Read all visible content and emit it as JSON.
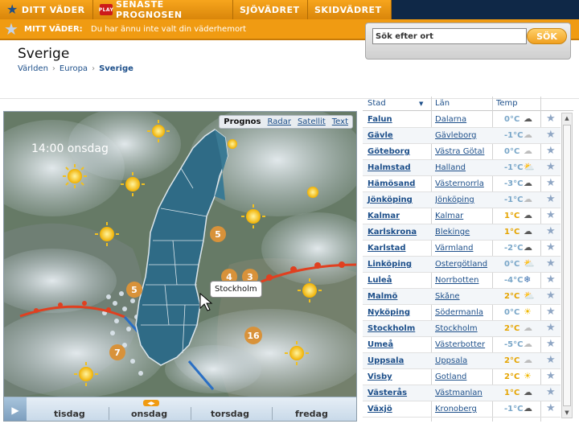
{
  "nav": {
    "tabs": [
      {
        "label": "DITT VÄDER"
      },
      {
        "label": "SENASTE PROGNOSEN"
      },
      {
        "label": "SJÖVÄDRET"
      },
      {
        "label": "SKIDVÄDRET"
      }
    ],
    "play_badge": "PLAY"
  },
  "subnav": {
    "label": "MITT VÄDER:",
    "message": "Du har ännu inte valt din väderhemort"
  },
  "search": {
    "value": "Sök efter ort",
    "button": "SÖK"
  },
  "page": {
    "title": "Sverige",
    "breadcrumb": [
      "Världen",
      "Europa",
      "Sverige"
    ]
  },
  "map": {
    "tabs": [
      "Prognos",
      "Radar",
      "Satellit",
      "Text"
    ],
    "time_label": "14:00 onsdag",
    "city_label": "Stockholm",
    "markers": [
      "5",
      "4",
      "3",
      "5",
      "7",
      "16"
    ],
    "days": [
      "tisdag",
      "onsdag",
      "torsdag",
      "fredag"
    ]
  },
  "table": {
    "headers": {
      "city": "Stad",
      "county": "Län",
      "temp": "Temp"
    },
    "rows": [
      {
        "city": "Falun",
        "county": "Dalarna",
        "temp": "0°C",
        "icon": "cloud-icon",
        "temp_color": "#7aa7c9"
      },
      {
        "city": "Gävle",
        "county": "Gävleborg",
        "temp": "-1°C",
        "icon": "cloud-outline-icon",
        "temp_color": "#7aa7c9"
      },
      {
        "city": "Göteborg",
        "county": "Västra Götal",
        "temp": "0°C",
        "icon": "cloud-outline-icon",
        "temp_color": "#7aa7c9"
      },
      {
        "city": "Halmstad",
        "county": "Halland",
        "temp": "-1°C",
        "icon": "partly-cloudy-icon",
        "temp_color": "#7aa7c9"
      },
      {
        "city": "Hämösand",
        "county": "Västernorrla",
        "temp": "-3°C",
        "icon": "cloud-icon",
        "temp_color": "#7aa7c9"
      },
      {
        "city": "Jönköping",
        "county": "Jönköping",
        "temp": "-1°C",
        "icon": "cloud-outline-icon",
        "temp_color": "#7aa7c9"
      },
      {
        "city": "Kalmar",
        "county": "Kalmar",
        "temp": "1°C",
        "icon": "cloud-icon",
        "temp_color": "#e5a400"
      },
      {
        "city": "Karlskrona",
        "county": "Blekinge",
        "temp": "1°C",
        "icon": "cloud-icon",
        "temp_color": "#e5a400"
      },
      {
        "city": "Karlstad",
        "county": "Värmland",
        "temp": "-2°C",
        "icon": "cloud-icon",
        "temp_color": "#7aa7c9"
      },
      {
        "city": "Linköping",
        "county": "Östergötland",
        "temp": "0°C",
        "icon": "partly-cloudy-icon",
        "temp_color": "#7aa7c9"
      },
      {
        "city": "Luleå",
        "county": "Norrbotten",
        "temp": "-4°C",
        "icon": "snow-sun-icon",
        "temp_color": "#7aa7c9"
      },
      {
        "city": "Malmö",
        "county": "Skåne",
        "temp": "2°C",
        "icon": "partly-sunny-icon",
        "temp_color": "#e5a400"
      },
      {
        "city": "Nyköping",
        "county": "Södermanla",
        "temp": "0°C",
        "icon": "sun-icon",
        "temp_color": "#7aa7c9"
      },
      {
        "city": "Stockholm",
        "county": "Stockholm",
        "temp": "2°C",
        "icon": "cloud-outline-icon",
        "temp_color": "#e5a400"
      },
      {
        "city": "Umeå",
        "county": "Västerbotter",
        "temp": "-5°C",
        "icon": "cloud-outline-icon",
        "temp_color": "#7aa7c9"
      },
      {
        "city": "Uppsala",
        "county": "Uppsala",
        "temp": "2°C",
        "icon": "cloud-outline-icon",
        "temp_color": "#e5a400"
      },
      {
        "city": "Visby",
        "county": "Gotland",
        "temp": "2°C",
        "icon": "sun-icon",
        "temp_color": "#e5a400"
      },
      {
        "city": "Västerås",
        "county": "Västmanlan",
        "temp": "1°C",
        "icon": "cloud-icon",
        "temp_color": "#e5a400"
      },
      {
        "city": "Växjö",
        "county": "Kronoberg",
        "temp": "-1°C",
        "icon": "cloud-icon",
        "temp_color": "#7aa7c9"
      }
    ]
  }
}
